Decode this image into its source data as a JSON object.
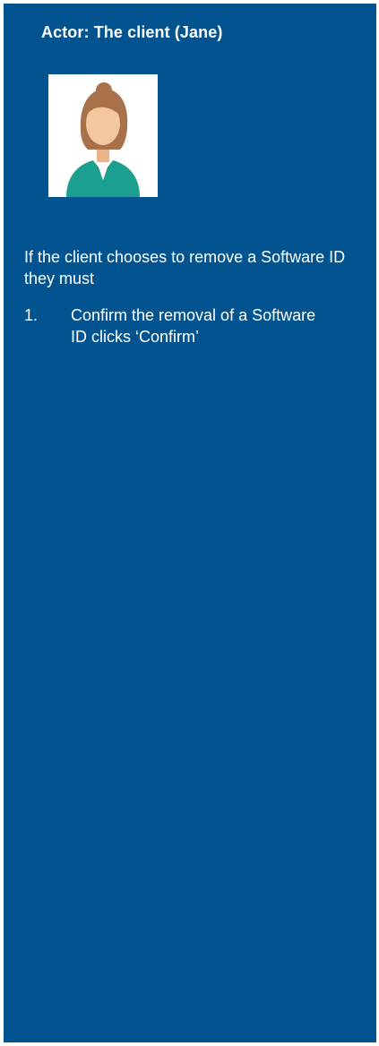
{
  "actor": {
    "title": "Actor: The client (Jane)",
    "avatar_icon": "female-user-icon"
  },
  "intro_text": "If the client chooses to remove a Software ID they must",
  "steps": [
    {
      "number": "1.",
      "text": "Confirm the removal of a Software ID clicks ‘Confirm’"
    }
  ],
  "colors": {
    "panel_background": "#01548f",
    "text": "#ffffff",
    "avatar_skin": "#f3c7a0",
    "avatar_hair": "#a9714a",
    "avatar_shirt": "#1a9f91"
  }
}
